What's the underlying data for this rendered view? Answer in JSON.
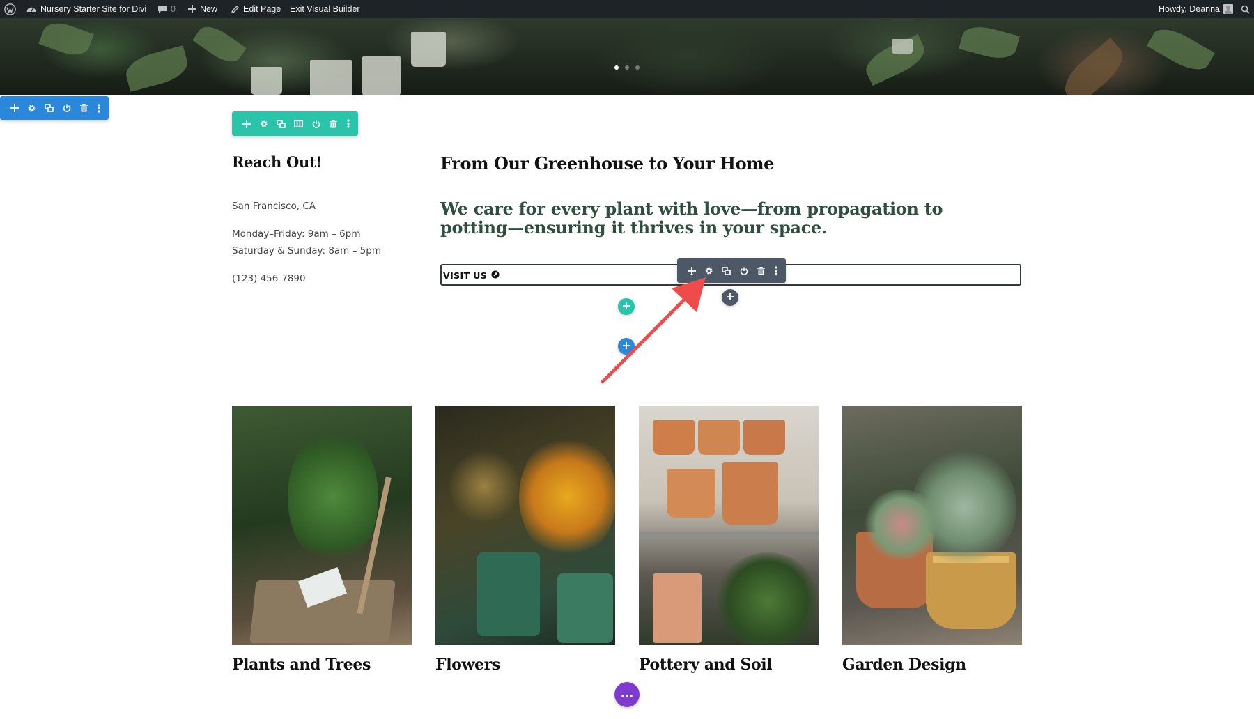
{
  "admin_bar": {
    "site_name": "Nursery Starter Site for Divi",
    "comments_count": "0",
    "new_label": "New",
    "edit_page_label": "Edit Page",
    "exit_builder_label": "Exit Visual Builder",
    "greeting": "Howdy, Deanna",
    "icons": [
      "wordpress-icon",
      "dashboard-icon",
      "comment-icon",
      "plus-icon",
      "pencil-icon",
      "search-icon"
    ]
  },
  "hero": {
    "slider_dots": 3,
    "active_dot": 1
  },
  "toolbars": {
    "section": {
      "color": "#2b87da",
      "icons": [
        "move-icon",
        "gear-icon",
        "duplicate-icon",
        "power-icon",
        "trash-icon",
        "more-icon"
      ]
    },
    "row": {
      "color": "#29c4a9",
      "icons": [
        "move-icon",
        "gear-icon",
        "duplicate-icon",
        "columns-icon",
        "power-icon",
        "trash-icon",
        "more-icon"
      ]
    },
    "module": {
      "color": "#4c5866",
      "icons": [
        "move-icon",
        "gear-icon",
        "duplicate-icon",
        "power-icon",
        "trash-icon",
        "more-icon"
      ]
    }
  },
  "contact": {
    "heading": "Reach Out!",
    "location": "San Francisco, CA",
    "hours_weekday": "Monday–Friday: 9am – 6pm",
    "hours_weekend": "Saturday & Sunday: 8am – 5pm",
    "phone": "(123) 456-7890"
  },
  "main": {
    "heading": "From Our Greenhouse to Your Home",
    "tagline": "We care for every plant with love—from propagation to potting—ensuring it thrives in your space.",
    "button_label": "VISIT US",
    "button_icon": "arrow-circle-icon"
  },
  "builder_controls": {
    "add_module_color": "#29c4a9",
    "add_row_color": "#2b87da",
    "add_module_dark_color": "#4c5866",
    "page_settings_color": "#7e3bd0",
    "annotation_arrow_color": "#ef4b4b"
  },
  "categories": [
    {
      "title": "Plants and Trees"
    },
    {
      "title": "Flowers"
    },
    {
      "title": "Pottery and Soil"
    },
    {
      "title": "Garden Design"
    }
  ]
}
